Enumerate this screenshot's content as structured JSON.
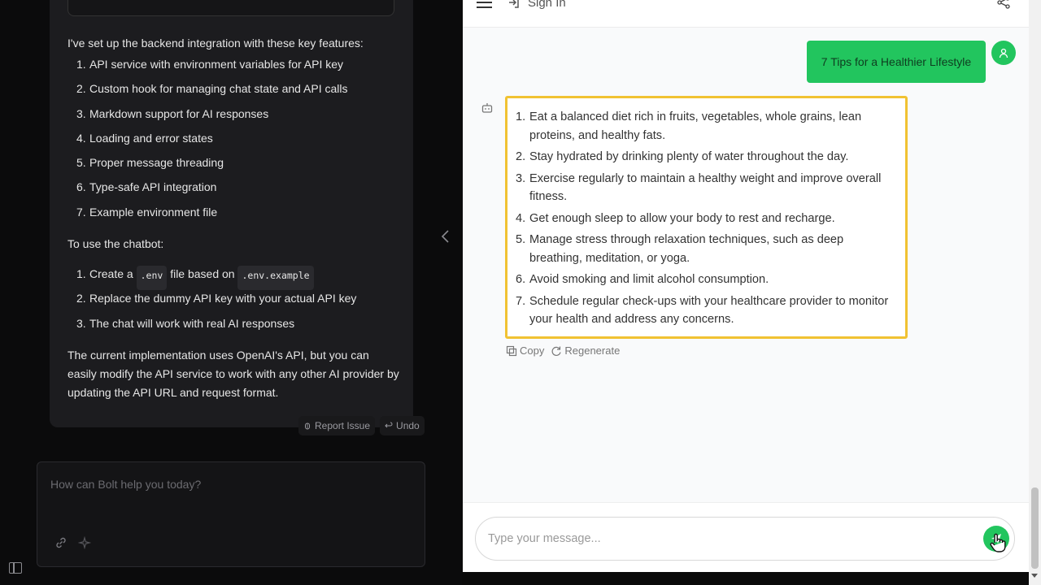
{
  "bolt": {
    "intro": "I've set up the backend integration with these key features:",
    "features": [
      {
        "n": "1.",
        "text": "API service with environment variables for API key"
      },
      {
        "n": "2.",
        "text": "Custom hook for managing chat state and API calls"
      },
      {
        "n": "3.",
        "text": "Markdown support for AI responses"
      },
      {
        "n": "4.",
        "text": "Loading and error states"
      },
      {
        "n": "5.",
        "text": "Proper message threading"
      },
      {
        "n": "6.",
        "text": "Type-safe API integration"
      },
      {
        "n": "7.",
        "text": "Example environment file"
      }
    ],
    "usage_heading": "To use the chatbot:",
    "steps": {
      "s1_n": "1.",
      "s1_pre": "Create a",
      "s1_code1": ".env",
      "s1_mid": "file based on",
      "s1_code2": ".env.example",
      "s2_n": "2.",
      "s2_text": "Replace the dummy API key with your actual API key",
      "s3_n": "3.",
      "s3_text": "The chat will work with real AI responses"
    },
    "closing": "The current implementation uses OpenAI's API, but you can easily modify the API service to work with any other AI provider by updating the API URL and request format.",
    "report_issue": "Report Issue",
    "undo": "Undo",
    "prompt_placeholder": "How can Bolt help you today?"
  },
  "preview": {
    "signin": "Sign In",
    "user_message": "7 Tips for a Healthier Lifestyle",
    "tips": [
      {
        "n": "1.",
        "text": "Eat a balanced diet rich in fruits, vegetables, whole grains, lean proteins, and healthy fats."
      },
      {
        "n": "2.",
        "text": "Stay hydrated by drinking plenty of water throughout the day."
      },
      {
        "n": "3.",
        "text": "Exercise regularly to maintain a healthy weight and improve overall fitness."
      },
      {
        "n": "4.",
        "text": "Get enough sleep to allow your body to rest and recharge."
      },
      {
        "n": "5.",
        "text": "Manage stress through relaxation techniques, such as deep breathing, meditation, or yoga."
      },
      {
        "n": "6.",
        "text": "Avoid smoking and limit alcohol consumption."
      },
      {
        "n": "7.",
        "text": "Schedule regular check-ups with your healthcare provider to monitor your health and address any concerns."
      }
    ],
    "copy": "Copy",
    "regenerate": "Regenerate",
    "input_placeholder": "Type your message..."
  },
  "colors": {
    "accent_green": "#22c55e",
    "highlight_border": "#f1c232",
    "dark_bg": "#0b0b0c",
    "card_bg": "#1c1c1f"
  },
  "icons": [
    "hamburger-icon",
    "sign-in-icon",
    "share-icon",
    "user-icon",
    "bot-icon",
    "copy-icon",
    "regenerate-icon",
    "send-icon",
    "link-icon",
    "sparkle-icon",
    "sidebar-toggle-icon",
    "chevron-left-icon",
    "bug-icon",
    "undo-icon"
  ]
}
